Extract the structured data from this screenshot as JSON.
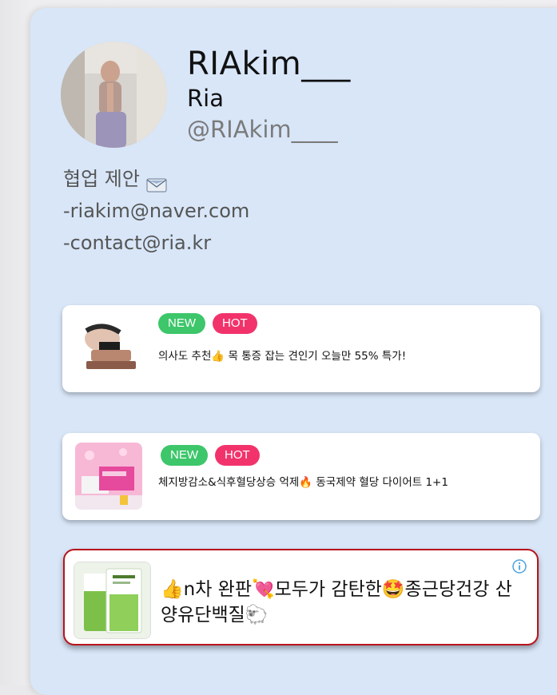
{
  "profile": {
    "username": "RIAkim___",
    "display_name": "Ria",
    "handle": "@RIAkim____",
    "avatar_icon": "profile-photo"
  },
  "bio": {
    "lines": [
      "협업 제안",
      "-riakim@naver.com",
      "-contact@ria.kr"
    ],
    "icon": "envelope-icon"
  },
  "ads": [
    {
      "badges": [
        "NEW",
        "HOT"
      ],
      "text": "의사도 추천👍 목 통증 잡는 견인기 오늘만 55% 특가!"
    },
    {
      "badges": [
        "NEW",
        "HOT"
      ],
      "text": "체지방감소&식후혈당상승 억제🔥 동국제약 혈당 다이어트 1+1"
    },
    {
      "badges": [],
      "text": "👍n차 완판💘모두가 감탄한🤩종근당건강 산양유단백질🐑",
      "highlighted": true,
      "info_icon": "info-icon"
    }
  ],
  "colors": {
    "card_bg": "#d8e6f8",
    "badge_new": "#3dc66a",
    "badge_hot": "#f2336b",
    "highlight_border": "#b8141c"
  }
}
